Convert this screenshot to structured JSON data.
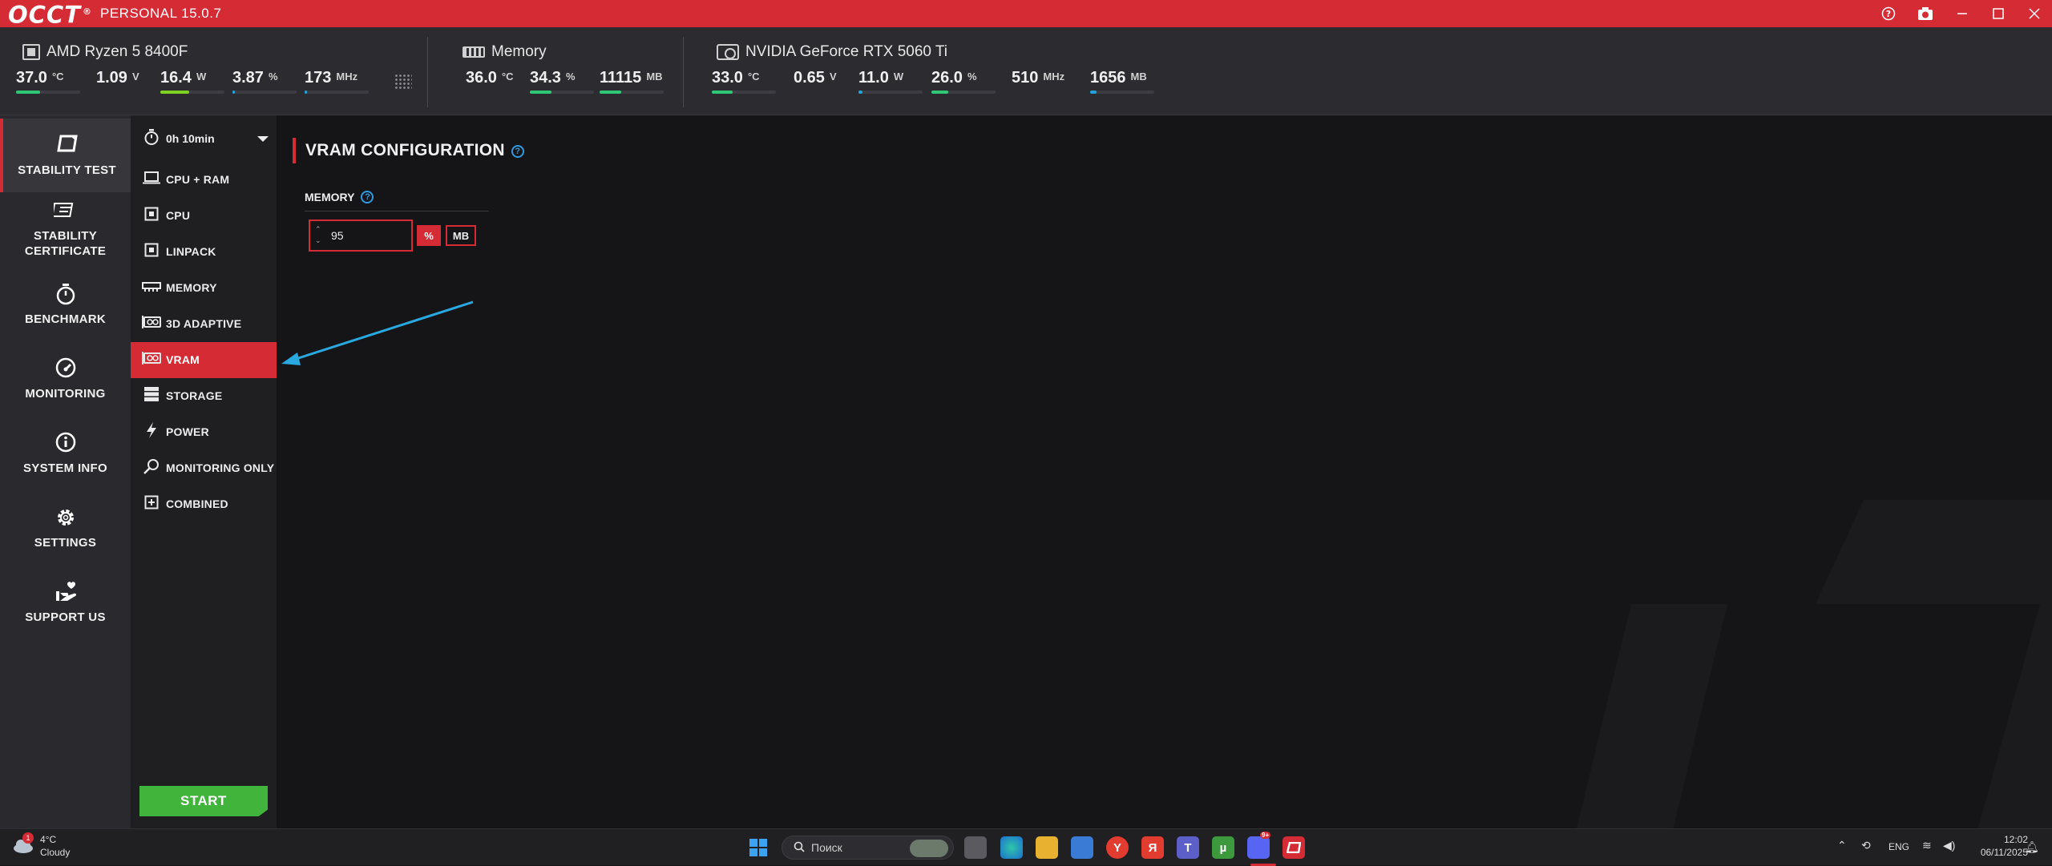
{
  "app": {
    "logo": "OCCT",
    "edition": "PERSONAL 15.0.7",
    "title_buttons": [
      "help-icon",
      "camera-icon",
      "minimize-icon",
      "maximize-icon",
      "close-icon"
    ]
  },
  "header": {
    "cpu": {
      "name": "AMD Ryzen 5 8400F",
      "sensors": [
        {
          "value": "37.0",
          "unit": "°C",
          "level": 0.37,
          "color": "#2fc877"
        },
        {
          "value": "1.09",
          "unit": "V",
          "level": null
        },
        {
          "value": "16.4",
          "unit": "W",
          "level": 0.45,
          "color": "#7ed321"
        },
        {
          "value": "3.87",
          "unit": "%",
          "level": 0.04,
          "color": "#1fa3e0"
        },
        {
          "value": "173",
          "unit": "MHz",
          "level": 0.03,
          "color": "#1fa3e0"
        }
      ]
    },
    "memory": {
      "name": "Memory",
      "sensors": [
        {
          "value": "36.0",
          "unit": "°C",
          "level": null
        },
        {
          "value": "34.3",
          "unit": "%",
          "level": 0.343,
          "color": "#2fc877"
        },
        {
          "value": "11115",
          "unit": "MB",
          "level": 0.34,
          "color": "#2fc877"
        }
      ]
    },
    "gpu": {
      "name": "NVIDIA GeForce RTX 5060 Ti",
      "sensors": [
        {
          "value": "33.0",
          "unit": "°C",
          "level": 0.33,
          "color": "#2fc877"
        },
        {
          "value": "0.65",
          "unit": "V",
          "level": null
        },
        {
          "value": "11.0",
          "unit": "W",
          "level": 0.06,
          "color": "#1fa3e0"
        },
        {
          "value": "26.0",
          "unit": "%",
          "level": 0.26,
          "color": "#2fc877"
        },
        {
          "value": "510",
          "unit": "MHz",
          "level": null
        },
        {
          "value": "1656",
          "unit": "MB",
          "level": 0.1,
          "color": "#1fa3e0"
        }
      ]
    }
  },
  "leftnav": [
    {
      "label": "STABILITY TEST",
      "icon": "stability-test-icon",
      "active": true
    },
    {
      "label": "STABILITY CERTIFICATE",
      "icon": "certificate-icon"
    },
    {
      "label": "BENCHMARK",
      "icon": "stopwatch-icon"
    },
    {
      "label": "MONITORING",
      "icon": "gauge-icon"
    },
    {
      "label": "SYSTEM INFO",
      "icon": "info-icon"
    },
    {
      "label": "SETTINGS",
      "icon": "gear-icon"
    },
    {
      "label": "SUPPORT US",
      "icon": "heart-hand-icon"
    }
  ],
  "subnav": {
    "timer": "0h 10min",
    "items": [
      {
        "label": "CPU + RAM",
        "icon": "laptop-icon"
      },
      {
        "label": "CPU",
        "icon": "chip-icon"
      },
      {
        "label": "LINPACK",
        "icon": "chip-icon"
      },
      {
        "label": "MEMORY",
        "icon": "ram-icon"
      },
      {
        "label": "3D ADAPTIVE",
        "icon": "gpu-icon"
      },
      {
        "label": "VRAM",
        "icon": "gpu-icon",
        "active": true
      },
      {
        "label": "STORAGE",
        "icon": "storage-icon"
      },
      {
        "label": "POWER",
        "icon": "lightning-icon"
      },
      {
        "label": "MONITORING ONLY",
        "icon": "magnifier-icon"
      },
      {
        "label": "COMBINED",
        "icon": "plus-box-icon"
      }
    ],
    "start": "START"
  },
  "config": {
    "title": "VRAM CONFIGURATION",
    "memory_label": "MEMORY",
    "memory_value": "95",
    "unit_percent": "%",
    "unit_mb": "MB",
    "selected_unit": "%"
  },
  "annotation": {
    "arrow_color": "#2aa8e0"
  },
  "taskbar": {
    "weather_temp": "4°C",
    "weather_desc": "Cloudy",
    "weather_badge": "1",
    "search_placeholder": "Поиск",
    "lang": "ENG",
    "time": "12:02",
    "date": "06/11/2025",
    "discord_badge": "9+"
  }
}
